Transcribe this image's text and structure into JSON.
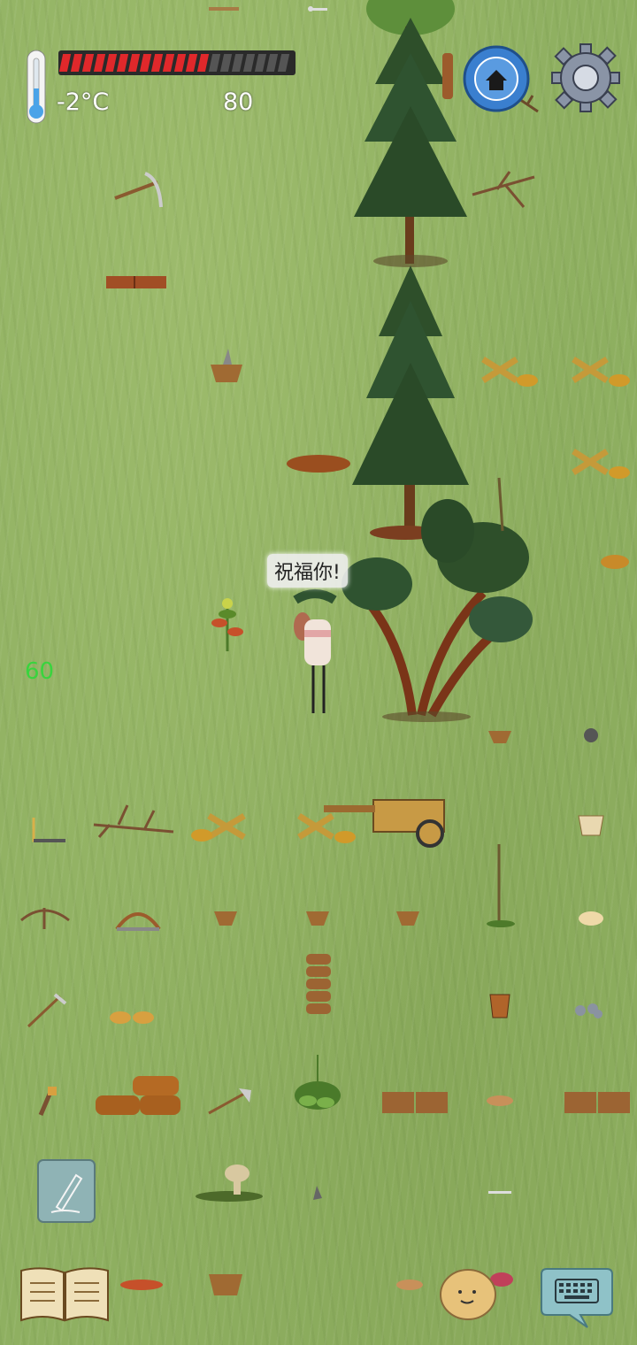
{
  "hud": {
    "temperature": "-2°C",
    "health_value": "80",
    "health_fill_fraction": 0.65,
    "health_segments": 20
  },
  "floating_text": "60",
  "speech_bubble": "祝福你!",
  "colors": {
    "grass": "#8fb061",
    "health_red": "#e0282b",
    "health_empty": "#555555",
    "float_text": "#39d43e",
    "home_button": "#3a7fcf"
  },
  "icons": {
    "thermometer": "thermometer-icon",
    "home": "home-icon",
    "settings": "gear-icon",
    "edit": "pencil-icon",
    "journal": "book-icon",
    "emote": "potato-face-icon",
    "chat": "keyboard-icon"
  }
}
